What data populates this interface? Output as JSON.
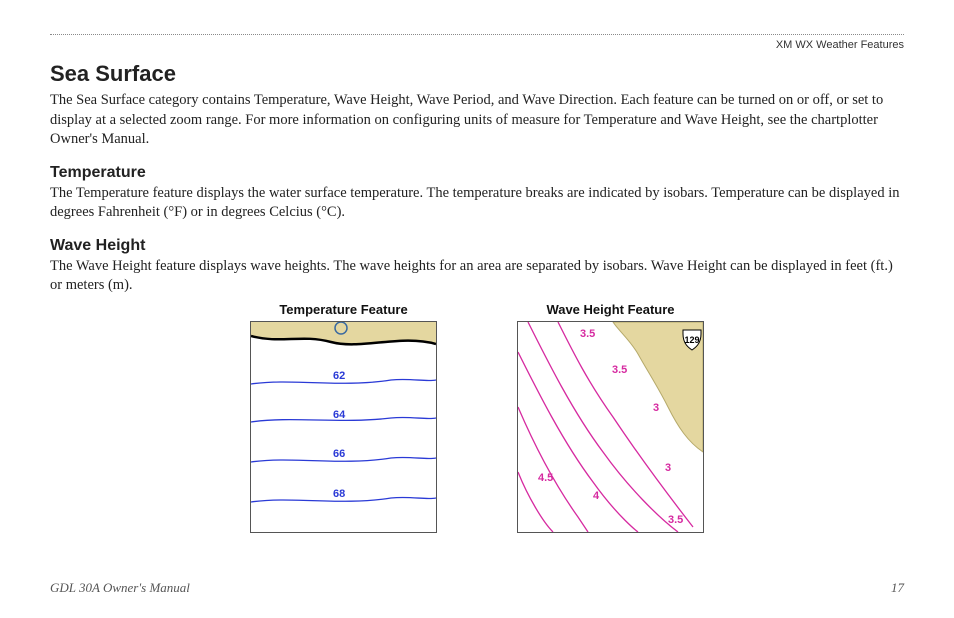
{
  "header": {
    "breadcrumb": "XM WX Weather Features"
  },
  "title": "Sea Surface",
  "intro": "The Sea Surface category contains Temperature, Wave Height, Wave Period, and Wave Direction. Each feature can be turned on or off, or set to display at a selected zoom range. For more information on configuring units of measure for Temperature and Wave Height, see the chartplotter Owner's Manual.",
  "sections": {
    "temperature": {
      "heading": "Temperature",
      "body": "The Temperature feature displays the water surface temperature. The temperature breaks are indicated by isobars. Temperature can be displayed in degrees Fahrenheit (°F) or in degrees Celcius (°C)."
    },
    "wave_height": {
      "heading": "Wave Height",
      "body": "The Wave Height feature displays wave heights. The wave heights for an area are separated by isobars. Wave Height can be displayed in feet (ft.) or meters (m)."
    }
  },
  "figures": {
    "temperature": {
      "title": "Temperature Feature",
      "isobars": [
        "62",
        "64",
        "66",
        "68"
      ]
    },
    "wave_height": {
      "title": "Wave Height Feature",
      "isobars": [
        "3.5",
        "3.5",
        "3",
        "4.5",
        "4",
        "3",
        "3.5"
      ],
      "road_label": "129"
    }
  },
  "footer": {
    "manual": "GDL 30A Owner's Manual",
    "page": "17"
  }
}
